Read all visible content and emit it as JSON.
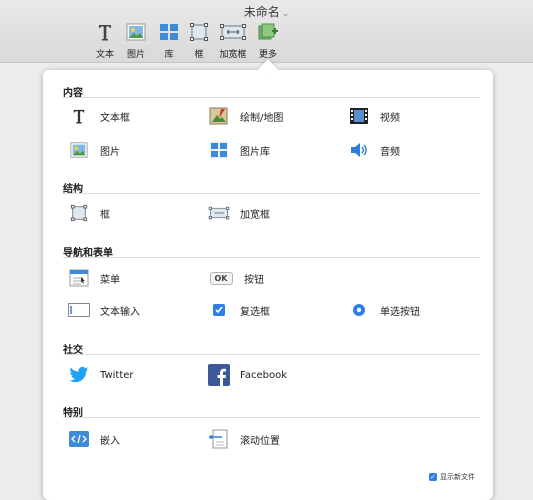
{
  "window": {
    "doc_title": "未命名"
  },
  "toolbar": {
    "text": "文本",
    "image": "图片",
    "library": "库",
    "frame": "框",
    "wide_frame": "加宽框",
    "more": "更多"
  },
  "sections": {
    "content": {
      "title": "内容",
      "text_box": "文本框",
      "drawing_map": "绘制/地图",
      "video": "视频",
      "image": "图片",
      "gallery": "图片库",
      "audio": "音频"
    },
    "structure": {
      "title": "结构",
      "frame": "框",
      "wide_frame": "加宽框"
    },
    "navigation": {
      "title": "导航和表单",
      "menu": "菜单",
      "button": "按钮",
      "ok_label": "OK",
      "text_input": "文本输入",
      "checkbox": "复选框",
      "radio": "单选按钮"
    },
    "social": {
      "title": "社交",
      "twitter": "Twitter",
      "facebook": "Facebook"
    },
    "special": {
      "title": "特别",
      "embed": "嵌入",
      "scroll_position": "滚动位置"
    }
  },
  "footer": {
    "show_new_file": "显示新文件"
  },
  "colors": {
    "accent": "#2d7ee6",
    "facebook": "#3b5998",
    "twitter": "#1da1f2"
  }
}
